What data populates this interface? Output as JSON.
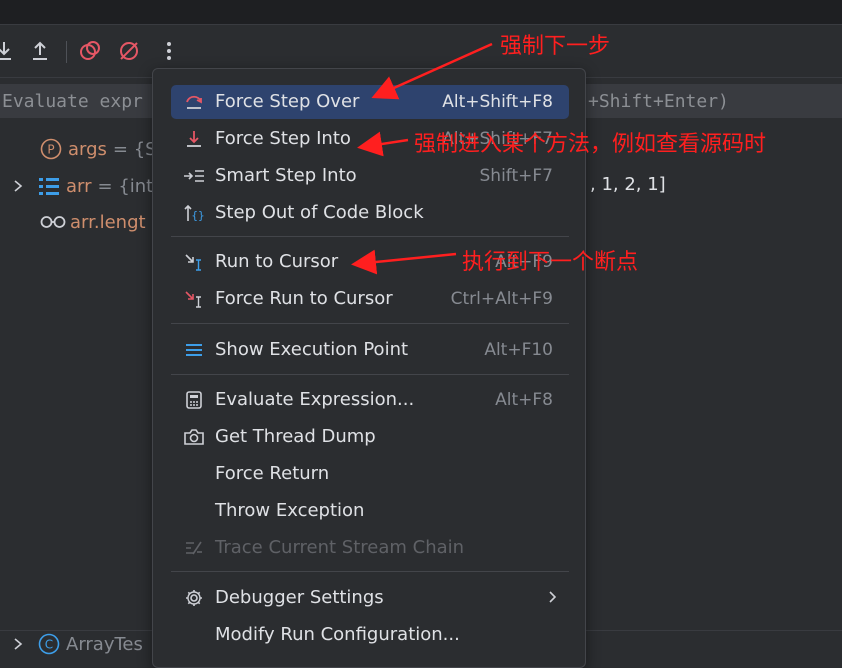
{
  "eval_bar": {
    "placeholder_left": "Evaluate expr",
    "placeholder_right": "+Shift+Enter)"
  },
  "variables": [
    {
      "name": "args",
      "value": "= {S"
    },
    {
      "name": "arr",
      "value": "= {int"
    },
    {
      "name": "arr.lengt",
      "value": ""
    }
  ],
  "arr_value_tail": ", 1, 2, 1]",
  "bottom_frame": {
    "label": "ArrayTes"
  },
  "menu": {
    "items": [
      {
        "label": "Force Step Over",
        "shortcut": "Alt+Shift+F8",
        "icon": "force-step-over-icon",
        "selected": true
      },
      {
        "label": "Force Step Into",
        "shortcut": "Alt+Shift+F7",
        "icon": "force-step-into-icon"
      },
      {
        "label": "Smart Step Into",
        "shortcut": "Shift+F7",
        "icon": "smart-step-into-icon"
      },
      {
        "label": "Step Out of Code Block",
        "shortcut": "",
        "icon": "step-out-code-block-icon"
      },
      {
        "label": "Run to Cursor",
        "shortcut": "Alt+F9",
        "icon": "run-to-cursor-icon"
      },
      {
        "label": "Force Run to Cursor",
        "shortcut": "Ctrl+Alt+F9",
        "icon": "force-run-to-cursor-icon"
      },
      {
        "label": "Show Execution Point",
        "shortcut": "Alt+F10",
        "icon": "show-execution-point-icon"
      },
      {
        "label": "Evaluate Expression...",
        "shortcut": "Alt+F8",
        "icon": "calculator-icon"
      },
      {
        "label": "Get Thread Dump",
        "shortcut": "",
        "icon": "camera-icon"
      },
      {
        "label": "Force Return",
        "shortcut": "",
        "icon": ""
      },
      {
        "label": "Throw Exception",
        "shortcut": "",
        "icon": ""
      },
      {
        "label": "Trace Current Stream Chain",
        "shortcut": "",
        "icon": "stream-chain-icon",
        "disabled": true
      },
      {
        "label": "Debugger Settings",
        "shortcut": "",
        "icon": "gear-icon",
        "submenu": true
      },
      {
        "label": "Modify Run Configuration...",
        "shortcut": "",
        "icon": ""
      }
    ]
  },
  "annotations": {
    "step_over": "强制下一步",
    "step_into": "强制进入某个方法，例如查看源码时",
    "run_to_cursor": "执行到下一个断点"
  },
  "colors": {
    "annotation": "#ff1f1f",
    "selected_bg": "#2e436e",
    "menu_bg": "#2b2d30"
  }
}
